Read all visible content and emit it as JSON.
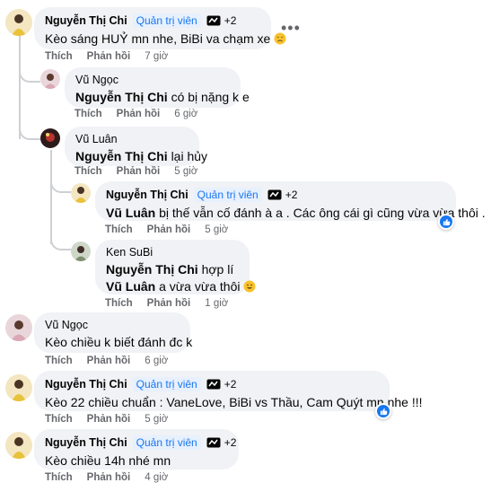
{
  "labels": {
    "like": "Thích",
    "reply": "Phản hồi",
    "more": "•••"
  },
  "comments": [
    {
      "name": "Nguyễn Thị Chi",
      "role": "Quản trị viên",
      "badge_count": "+2",
      "text": "Kèo sáng HUỶ mn nhe, BiBi va chạm xe",
      "emoji": "persevering-face",
      "time": "7 giờ"
    },
    {
      "name": "Vũ Ngọc",
      "tag": "Nguyễn Thị Chi",
      "text": "có bị nặng k e",
      "time": "6 giờ"
    },
    {
      "name": "Vũ Luân",
      "tag": "Nguyễn Thị Chi",
      "text": "lại hủy",
      "time": "5 giờ"
    },
    {
      "name": "Nguyễn Thị Chi",
      "role": "Quản trị viên",
      "badge_count": "+2",
      "tag": "Vũ Luân",
      "text": "bị thế vẫn cố đánh à a . Các ông cái gì cũng vừa vừa thôi .",
      "reaction": "like-reaction",
      "time": "5 giờ"
    },
    {
      "name": "Ken SuBi",
      "line1_tag": "Nguyễn Thị Chi",
      "line1_text": "hợp lí",
      "line2_tag": "Vũ Luân",
      "line2_text": "a vừa vừa thôi",
      "emoji": "grinning-face",
      "time": "1 giờ"
    },
    {
      "name": "Vũ Ngọc",
      "text": "Kèo chiều k biết đánh đc k",
      "time": "6 giờ"
    },
    {
      "name": "Nguyễn Thị Chi",
      "role": "Quản trị viên",
      "badge_count": "+2",
      "text": "Kèo 22 chiều chuẩn : VaneLove, BiBi vs Thầu, Cam Quýt mn nhe !!!",
      "reaction": "like-reaction",
      "time": "5 giờ"
    },
    {
      "name": "Nguyễn Thị Chi",
      "role": "Quản trị viên",
      "badge_count": "+2",
      "text": "Kèo chiều 14h nhé mn",
      "time": "4 giờ"
    }
  ],
  "colors": {
    "bubble": "#f0f2f5",
    "accent": "#1877f2",
    "muted": "#65676b",
    "thread": "#ced0d4"
  }
}
